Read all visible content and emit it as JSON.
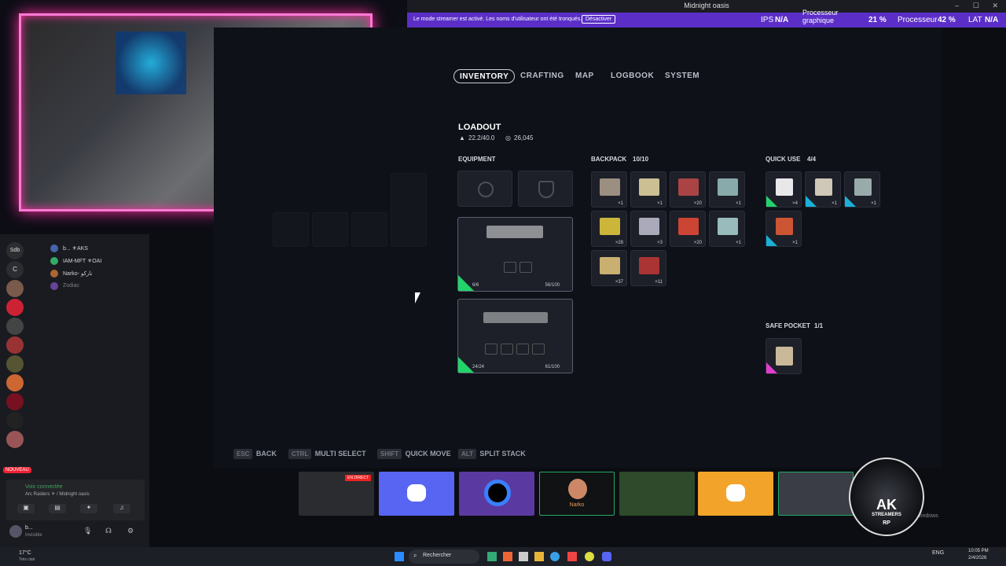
{
  "window": {
    "title": "Midnight oasis"
  },
  "streamer_bar": {
    "message": "Le mode streamer est activé. Les noms d'utilisateur ont été tronqués.",
    "button": "Désactiver"
  },
  "stats": {
    "ips_label": "IPS",
    "ips_value": "N/A",
    "gpu_label": "Processeur graphique",
    "gpu_value": "21 %",
    "cpu_label": "Processeur",
    "cpu_value": "42 %",
    "lat_label": "LAT",
    "lat_value": "N/A"
  },
  "tabs": [
    "INVENTORY",
    "CRAFTING",
    "MAP",
    "LOGBOOK",
    "SYSTEM"
  ],
  "loadout": {
    "title": "LOADOUT",
    "weight": "22.2/40.0",
    "money": "26,045"
  },
  "equipment": {
    "title": "EQUIPMENT",
    "weapon1": {
      "ammo": "6/6",
      "durability": "56/100"
    },
    "weapon2": {
      "ammo": "24/24",
      "durability": "61/100"
    }
  },
  "backpack": {
    "title": "BACKPACK",
    "count": "10/10",
    "items": [
      {
        "qty": "×1",
        "color": "#9a8f80"
      },
      {
        "qty": "×1",
        "color": "#cbbf93"
      },
      {
        "qty": "×20",
        "color": "#a44"
      },
      {
        "qty": "×1",
        "color": "#8aa"
      },
      {
        "qty": "×28",
        "color": "#cbb63a"
      },
      {
        "qty": "×3",
        "color": "#aab"
      },
      {
        "qty": "×20",
        "color": "#c43"
      },
      {
        "qty": "×1",
        "color": "#9bb"
      },
      {
        "qty": "×37",
        "color": "#c9b070"
      },
      {
        "qty": "×11",
        "color": "#a33"
      }
    ]
  },
  "quick_use": {
    "title": "QUICK USE",
    "count": "4/4",
    "items": [
      {
        "qty": "×4"
      },
      {
        "qty": "×1"
      },
      {
        "qty": "×1"
      },
      {
        "qty": "×1"
      }
    ]
  },
  "safe_pocket": {
    "title": "SAFE POCKET",
    "count": "1/1"
  },
  "hints": [
    {
      "key": "ESC",
      "label": "BACK"
    },
    {
      "key": "CTRL",
      "label": "MULTI SELECT"
    },
    {
      "key": "SHIFT",
      "label": "QUICK MOVE"
    },
    {
      "key": "ALT",
      "label": "SPLIT STACK"
    }
  ],
  "discord": {
    "servers": [
      "Sdb",
      "C"
    ],
    "users": [
      "b... ⚜AKS",
      "IAM-MFT ⚜OAI",
      "Narko- نارکو",
      "Zodiac"
    ],
    "voice_status": "Voix connectée",
    "voice_channel": "Arc Raiders ⚜ / Midnight oasis",
    "me_name": "b...",
    "me_status": "Invisible",
    "new_badge": "NOUVEAU"
  },
  "thumbs": {
    "live": "EN DIRECT",
    "narko": "Narko"
  },
  "activate": "Activer Windows",
  "taskbar": {
    "search": "Rechercher",
    "weather": "17°C",
    "weather_sub": "Très clair",
    "time": "10:05 PM",
    "date": "2/4/2026",
    "lang": "ENG"
  },
  "brand": {
    "badge": "AK",
    "badge_sub": "STREAMERS",
    "badge_rp": "RP"
  }
}
